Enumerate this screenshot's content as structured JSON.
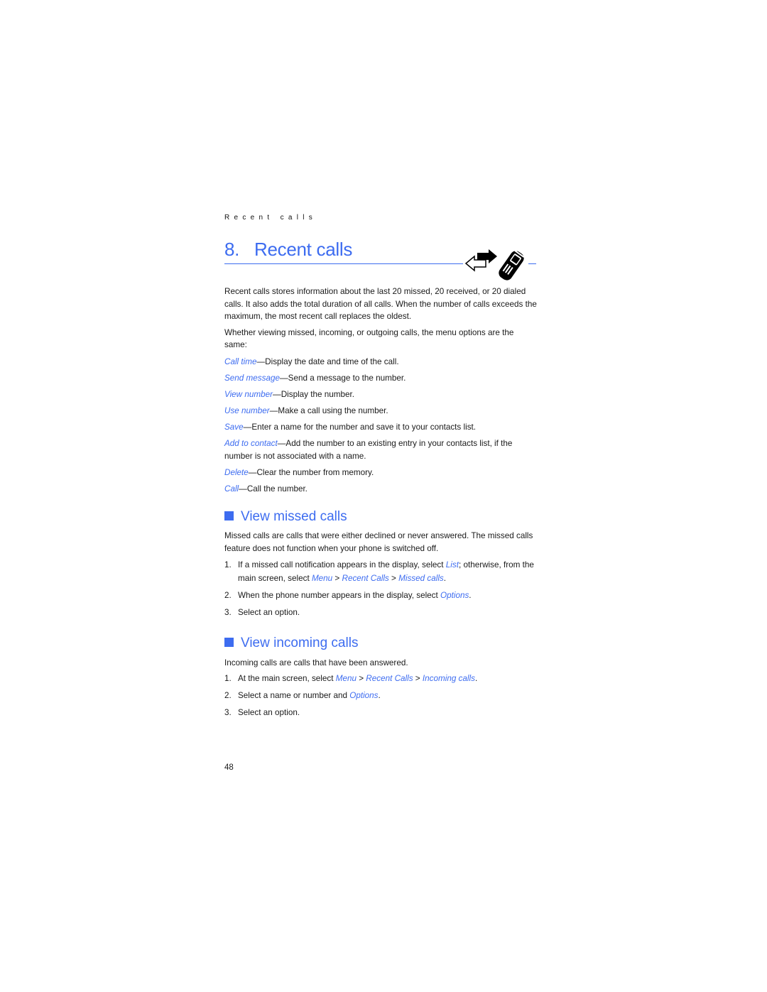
{
  "running_header": "Recent calls",
  "chapter": {
    "number": "8.",
    "title": "Recent calls",
    "icon": "arrows-and-phone-icon"
  },
  "intro": {
    "paragraph1": "Recent calls stores information about the last 20 missed, 20 received, or 20 dialed calls. It also adds the total duration of all calls. When the number of calls exceeds the maximum, the most recent call replaces the oldest.",
    "paragraph2": "Whether viewing missed, incoming, or outgoing calls, the menu options are the same:"
  },
  "options": [
    {
      "term": "Call time",
      "desc": "—Display the date and time of the call."
    },
    {
      "term": "Send message",
      "desc": "—Send a message to the number."
    },
    {
      "term": "View number",
      "desc": "—Display the number."
    },
    {
      "term": "Use number",
      "desc": "—Make a call using the number."
    },
    {
      "term": "Save",
      "desc": "—Enter a name for the number and save it to your contacts list."
    },
    {
      "term": "Add to contact",
      "desc": "—Add the number to an existing entry in your contacts list, if the number is not associated with a name."
    },
    {
      "term": "Delete",
      "desc": "—Clear the number from memory."
    },
    {
      "term": "Call",
      "desc": "—Call the number."
    }
  ],
  "missed": {
    "heading": "View missed calls",
    "body": "Missed calls are calls that were either declined or never answered. The missed calls feature does not function when your phone is switched off.",
    "steps": [
      {
        "n": "1.",
        "t1": "If a missed call notification appears in the display, select ",
        "l1": "List",
        "t2": "; otherwise, from the main screen, select ",
        "l2": "Menu",
        "t3": " > ",
        "l3": "Recent Calls",
        "t4": " > ",
        "l4": "Missed calls",
        "t5": "."
      },
      {
        "n": "2.",
        "t1": "When the phone number appears in the display, select ",
        "l1": "Options",
        "t2": "."
      },
      {
        "n": "3.",
        "t1": "Select an option."
      }
    ]
  },
  "incoming": {
    "heading": "View incoming calls",
    "body": "Incoming calls are calls that have been answered.",
    "steps": [
      {
        "n": "1.",
        "t1": "At the main screen, select ",
        "l1": "Menu",
        "t2": " > ",
        "l2": "Recent Calls",
        "t3": " > ",
        "l3": "Incoming calls",
        "t4": "."
      },
      {
        "n": "2.",
        "t1": "Select a name or number and ",
        "l1": "Options",
        "t2": "."
      },
      {
        "n": "3.",
        "t1": "Select an option."
      }
    ]
  },
  "page_number": "48",
  "colors": {
    "accent": "#3d6cf0",
    "text": "#1a1a1a"
  }
}
